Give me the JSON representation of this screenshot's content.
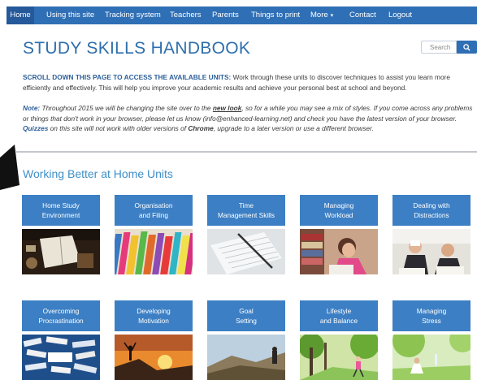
{
  "nav": {
    "items": [
      "Home",
      "Using this site",
      "Tracking system",
      "Teachers",
      "Parents",
      "Things to print",
      "More",
      "Contact",
      "Logout"
    ],
    "more_caret": "▾"
  },
  "page": {
    "title": "STUDY SKILLS HANDBOOK"
  },
  "search": {
    "placeholder": "Search"
  },
  "intro": {
    "lead": "SCROLL DOWN THIS PAGE TO ACCESS THE AVAILABLE UNITS:",
    "text": " Work through these units to discover techniques to assist you learn more efficiently and effectively. This will help you improve your academic results and achieve your personal best at school and beyond."
  },
  "note": {
    "label": "Note:",
    "t1": " Throughout 2015 we will be changing the site over to the ",
    "link": "new look",
    "t2": ", so for a while you may see a mix of styles. If you come across any problems or things that don't work in your browser, please let us know (info@enhanced-learning.net) and check you have the latest version of your browser. ",
    "quizzes": "Quizzes",
    "t3": " on this site will not work with older versions of ",
    "chrome": "Chrome",
    "t4": ", upgrade to a later version or use a different browser."
  },
  "section": {
    "title": "Working Better at Home Units"
  },
  "units": [
    {
      "label": "Home Study\nEnvironment",
      "image": "desk-with-book-photo"
    },
    {
      "label": "Organisation\nand Filing",
      "image": "colorful-folders-photo"
    },
    {
      "label": "Time\nManagement Skills",
      "image": "planner-and-pen-photo"
    },
    {
      "label": "Managing\nWorkload",
      "image": "student-with-books-photo"
    },
    {
      "label": "Dealing with\nDistractions",
      "image": "students-in-class-photo"
    },
    {
      "label": "Overcoming\nProcrastination",
      "image": "procrastination-words-photo"
    },
    {
      "label": "Developing\nMotivation",
      "image": "sunset-summit-photo"
    },
    {
      "label": "Goal\nSetting",
      "image": "hiker-on-hill-photo"
    },
    {
      "label": "Lifestyle\nand Balance",
      "image": "runner-in-park-photo"
    },
    {
      "label": "Managing\nStress",
      "image": "meditation-outdoors-photo"
    }
  ],
  "colors": {
    "nav": "#2f6fb5",
    "title": "#2e6fad",
    "section_title": "#3f8fc8",
    "card": "#3c7fc4"
  }
}
